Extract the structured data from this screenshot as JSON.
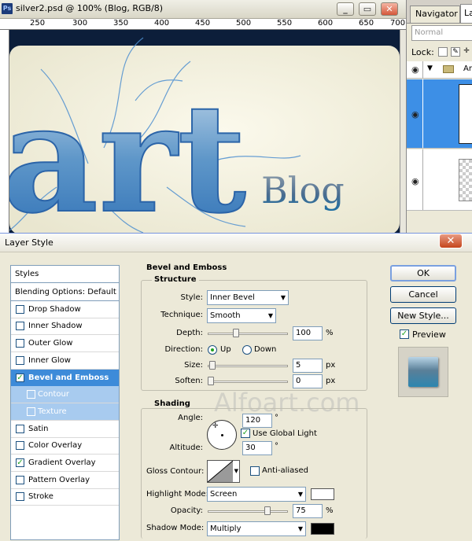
{
  "document": {
    "ps_icon": "Ps",
    "title": "silver2.psd @ 100% (Blog, RGB/8)",
    "window_buttons": {
      "minimize": "_",
      "restore": "▭",
      "close": "✕"
    },
    "ruler": [
      "250",
      "300",
      "350",
      "400",
      "450",
      "500",
      "550",
      "600",
      "650",
      "700"
    ],
    "canvas": {
      "headline": "art",
      "subtitle": "Blog"
    }
  },
  "panels": {
    "tab_navigator": "Navigator",
    "tab_layers": "Layers",
    "blend_mode": "Normal",
    "lock_label": "Lock:",
    "group_name": "Ar"
  },
  "dialog": {
    "title": "Layer Style",
    "close": "✕",
    "styles_header": "Styles",
    "styles": [
      {
        "label": "Blending Options: Default",
        "checkbox": false,
        "checked": false,
        "state": "header"
      },
      {
        "label": "Drop Shadow",
        "checkbox": true,
        "checked": false,
        "state": "normal"
      },
      {
        "label": "Inner Shadow",
        "checkbox": true,
        "checked": false,
        "state": "normal"
      },
      {
        "label": "Outer Glow",
        "checkbox": true,
        "checked": false,
        "state": "normal"
      },
      {
        "label": "Inner Glow",
        "checkbox": true,
        "checked": false,
        "state": "normal"
      },
      {
        "label": "Bevel and Emboss",
        "checkbox": true,
        "checked": true,
        "state": "selected"
      },
      {
        "label": "Contour",
        "checkbox": true,
        "checked": false,
        "state": "sub"
      },
      {
        "label": "Texture",
        "checkbox": true,
        "checked": false,
        "state": "sub"
      },
      {
        "label": "Satin",
        "checkbox": true,
        "checked": false,
        "state": "normal"
      },
      {
        "label": "Color Overlay",
        "checkbox": true,
        "checked": false,
        "state": "normal"
      },
      {
        "label": "Gradient Overlay",
        "checkbox": true,
        "checked": true,
        "state": "normal"
      },
      {
        "label": "Pattern Overlay",
        "checkbox": true,
        "checked": false,
        "state": "normal"
      },
      {
        "label": "Stroke",
        "checkbox": true,
        "checked": false,
        "state": "normal"
      }
    ],
    "section_title": "Bevel and Emboss",
    "structure": {
      "title": "Structure",
      "style_label": "Style:",
      "style_value": "Inner Bevel",
      "technique_label": "Technique:",
      "technique_value": "Smooth",
      "depth_label": "Depth:",
      "depth_value": "100",
      "depth_unit": "%",
      "direction_label": "Direction:",
      "direction_up": "Up",
      "direction_down": "Down",
      "size_label": "Size:",
      "size_value": "5",
      "size_unit": "px",
      "soften_label": "Soften:",
      "soften_value": "0",
      "soften_unit": "px"
    },
    "shading": {
      "title": "Shading",
      "angle_label": "Angle:",
      "angle_value": "120",
      "angle_unit": "°",
      "global_light": "Use Global Light",
      "altitude_label": "Altitude:",
      "altitude_value": "30",
      "altitude_unit": "°",
      "gloss_label": "Gloss Contour:",
      "anti_aliased": "Anti-aliased",
      "highlight_label": "Highlight Mode:",
      "highlight_value": "Screen",
      "opacity_label": "Opacity:",
      "opacity_value": "75",
      "opacity_unit": "%",
      "shadow_label": "Shadow Mode:",
      "shadow_value": "Multiply"
    },
    "buttons": {
      "ok": "OK",
      "cancel": "Cancel",
      "new_style": "New Style...",
      "preview": "Preview"
    },
    "watermark": "Alfoart.com",
    "colors": {
      "highlight": "#ffffff",
      "shadow": "#000000"
    }
  }
}
